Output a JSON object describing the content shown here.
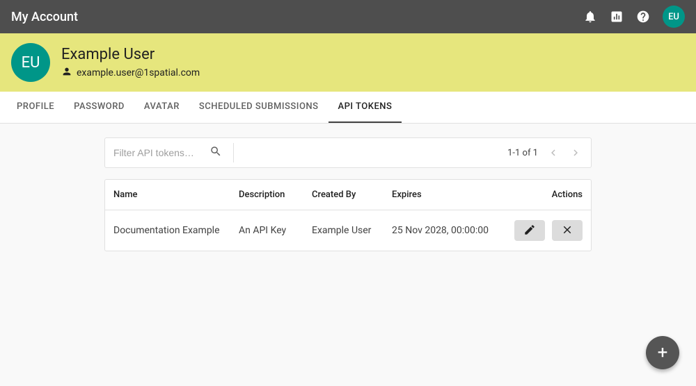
{
  "topbar": {
    "title": "My Account",
    "avatar_initials": "EU"
  },
  "user": {
    "initials": "EU",
    "name": "Example User",
    "email": "example.user@1spatial.com"
  },
  "tabs": [
    {
      "label": "Profile"
    },
    {
      "label": "Password"
    },
    {
      "label": "Avatar"
    },
    {
      "label": "Scheduled Submissions"
    },
    {
      "label": "API Tokens"
    }
  ],
  "filter": {
    "placeholder": "Filter API tokens…"
  },
  "pagination": {
    "text": "1-1 of 1"
  },
  "table": {
    "headers": {
      "name": "Name",
      "description": "Description",
      "created_by": "Created By",
      "expires": "Expires",
      "actions": "Actions"
    },
    "rows": [
      {
        "name": "Documentation Example",
        "description": "An API Key",
        "created_by": "Example User",
        "expires": "25 Nov 2028, 00:00:00"
      }
    ]
  },
  "fab": {
    "label": "+"
  }
}
